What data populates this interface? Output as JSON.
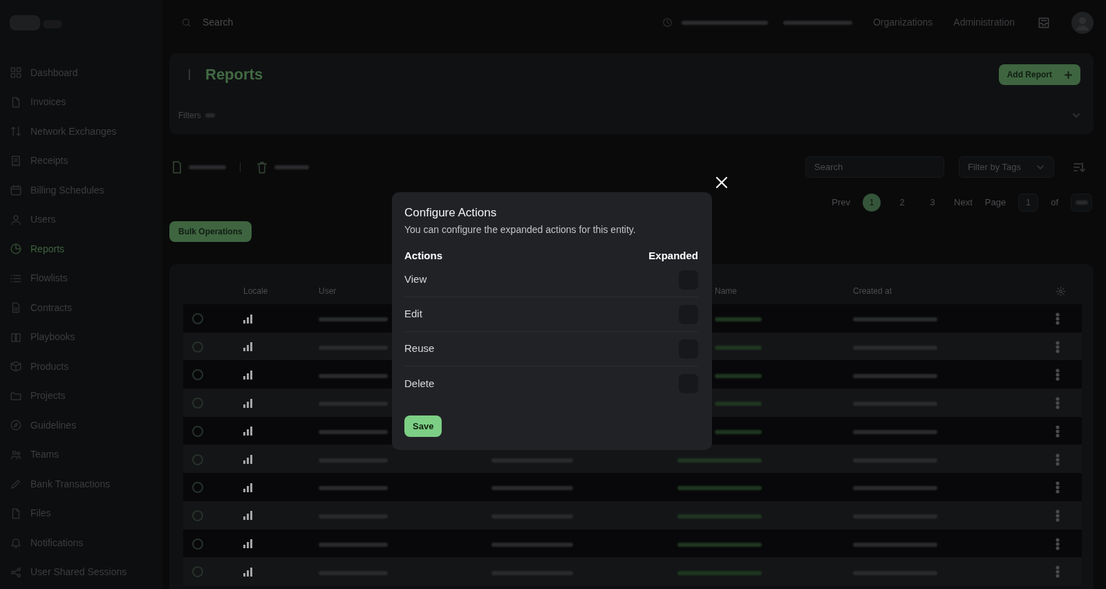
{
  "sidebar": {
    "items": [
      {
        "label": "Dashboard",
        "selected": false
      },
      {
        "label": "Invoices",
        "selected": false
      },
      {
        "label": "Network Exchanges",
        "selected": false
      },
      {
        "label": "Receipts",
        "selected": false
      },
      {
        "label": "Billing Schedules",
        "selected": false
      },
      {
        "label": "Users",
        "selected": false
      },
      {
        "label": "Reports",
        "selected": true
      },
      {
        "label": "Flowlists",
        "selected": false
      },
      {
        "label": "Contracts",
        "selected": false
      },
      {
        "label": "Playbooks",
        "selected": false
      },
      {
        "label": "Products",
        "selected": false
      },
      {
        "label": "Projects",
        "selected": false
      },
      {
        "label": "Guidelines",
        "selected": false
      },
      {
        "label": "Teams",
        "selected": false
      },
      {
        "label": "Bank Transactions",
        "selected": false
      },
      {
        "label": "Files",
        "selected": false
      },
      {
        "label": "Notifications",
        "selected": false
      },
      {
        "label": "User Shared Sessions",
        "selected": false
      }
    ]
  },
  "header": {
    "search": {
      "placeholder": "Search"
    },
    "links": [
      "Organizations",
      "Administration"
    ]
  },
  "page": {
    "title": "Reports",
    "add_button": "Add Report",
    "filters_label": "Filters"
  },
  "toolbar": {
    "search": {
      "placeholder": "Search"
    },
    "tag_filter": "Filter by Tags"
  },
  "pagination": {
    "prev": "Prev",
    "pages": [
      {
        "label": "1",
        "selected": true
      },
      {
        "label": "2",
        "selected": false
      },
      {
        "label": "3",
        "selected": false
      }
    ],
    "next": "Next",
    "page_label": "Page",
    "page_input": "1",
    "of_label": "of"
  },
  "bulk_button": "Bulk Operations",
  "table": {
    "columns": [
      {
        "label": "Locale"
      },
      {
        "label": "User"
      },
      {
        "label": "Name"
      },
      {
        "label": "Created at"
      }
    ],
    "rows": [
      {
        "checked": false
      },
      {
        "checked": false
      },
      {
        "checked": false
      },
      {
        "checked": false
      },
      {
        "checked": false
      },
      {
        "checked": false
      },
      {
        "checked": false
      },
      {
        "checked": false
      },
      {
        "checked": false
      },
      {
        "checked": false
      }
    ]
  },
  "modal": {
    "title": "Configure Actions",
    "description": "You can configure the expanded actions for this entity.",
    "columns": [
      "Actions",
      "Expanded"
    ],
    "actions": [
      {
        "label": "View",
        "expanded": false
      },
      {
        "label": "Edit",
        "expanded": false
      },
      {
        "label": "Reuse",
        "expanded": false
      },
      {
        "label": "Delete",
        "expanded": false
      }
    ],
    "save_button": "Save"
  }
}
